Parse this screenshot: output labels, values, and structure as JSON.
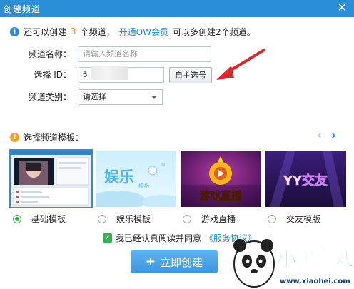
{
  "window": {
    "title": "创建频道",
    "close_glyph": "✕"
  },
  "notice": {
    "prefix": "还可以创建",
    "count": "3",
    "middle": "个频道，",
    "link": "开通OW会员",
    "suffix": "可以多创建2个频道。"
  },
  "form": {
    "name_label": "频道名称：",
    "name_placeholder": "请输入频道名称",
    "id_label": "选择 ID：",
    "id_value": "5",
    "self_select_button": "自主选号",
    "category_label": "频道类别：",
    "category_value": "请选择"
  },
  "templates": {
    "heading": "选择频道模板：",
    "prev_glyph": "‹",
    "next_glyph": "›",
    "items": [
      {
        "label": "基础模板",
        "selected": true,
        "thumb_text": ""
      },
      {
        "label": "娱乐模板",
        "selected": false,
        "thumb_text": "娱乐"
      },
      {
        "label": "游戏直播",
        "selected": false,
        "thumb_text": "游戏直播"
      },
      {
        "label": "交友模版",
        "selected": false,
        "thumb_text": "YY交友"
      }
    ],
    "thumb_sub": {
      "ent": "模板",
      "ent_badge": "N"
    }
  },
  "agreement": {
    "checked_glyph": "✓",
    "text": "我已经认真阅读并同意",
    "link": "《服务协议》"
  },
  "create_button": {
    "plus": "+",
    "label": "立即创建"
  },
  "watermark": {
    "brand": "小黑游戏",
    "url": "www.xiaohei.com"
  },
  "colors": {
    "accent": "#2a8fd6",
    "highlight": "#f47a1b",
    "check": "#3aae55",
    "arrow": "#e0262c"
  }
}
